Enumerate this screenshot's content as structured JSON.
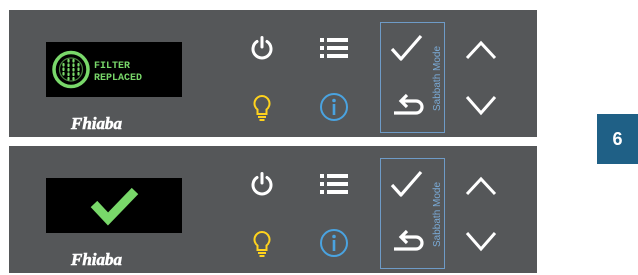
{
  "colors": {
    "panel_bg": "#555759",
    "display_bg": "#000000",
    "display_green": "#79d86a",
    "icon_white": "#ffffff",
    "bulb_yellow": "#ffd31d",
    "info_blue": "#4aa3e0",
    "sabbath_blue": "#7aaad6",
    "badge_blue": "#1f6086"
  },
  "panels": [
    {
      "display_icon": "filter-icon",
      "display_text": [
        "FILTER",
        "REPLACED"
      ],
      "brand": "Fhiaba",
      "sabbath_label": "Sabbath Mode"
    },
    {
      "display_icon": "checkmark-icon",
      "brand": "Fhiaba",
      "sabbath_label": "Sabbath Mode"
    }
  ],
  "icons": {
    "power": "power-icon",
    "menu": "menu-icon",
    "bulb": "light-bulb-icon",
    "info": "info-icon",
    "confirm": "checkmark-icon",
    "back": "back-arrow-icon",
    "up": "chevron-up-icon",
    "down": "chevron-down-icon"
  },
  "step_number": "6"
}
